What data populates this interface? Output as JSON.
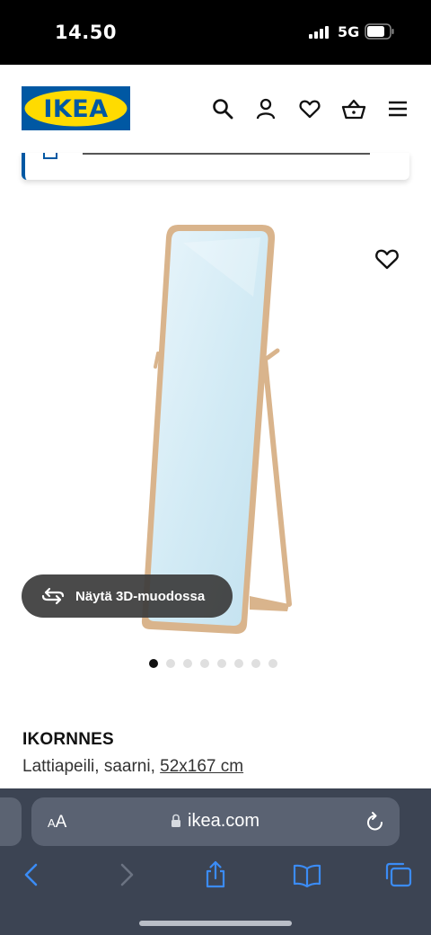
{
  "status_bar": {
    "time": "14.50",
    "network": "5G"
  },
  "header": {
    "logo_text": "IKEA",
    "icons": [
      "search-icon",
      "account-icon",
      "heart-icon",
      "basket-icon",
      "menu-icon"
    ]
  },
  "product": {
    "name": "IKORNNES",
    "description": "Lattiapeili, saarni, ",
    "size": "52x167 cm",
    "view_3d_label": "Näytä 3D-muodossa",
    "image_count": 8,
    "active_image": 1
  },
  "browser": {
    "text_size_label_small": "A",
    "text_size_label_large": "A",
    "url": "ikea.com",
    "toolbar_icons": [
      "back-icon",
      "forward-icon",
      "share-icon",
      "bookmarks-icon",
      "tabs-icon"
    ]
  },
  "colors": {
    "ikea_blue": "#0058a3",
    "ikea_yellow": "#ffdb00",
    "mirror_frame": "#d9b48c",
    "browser_accent": "#3b8cf5"
  }
}
